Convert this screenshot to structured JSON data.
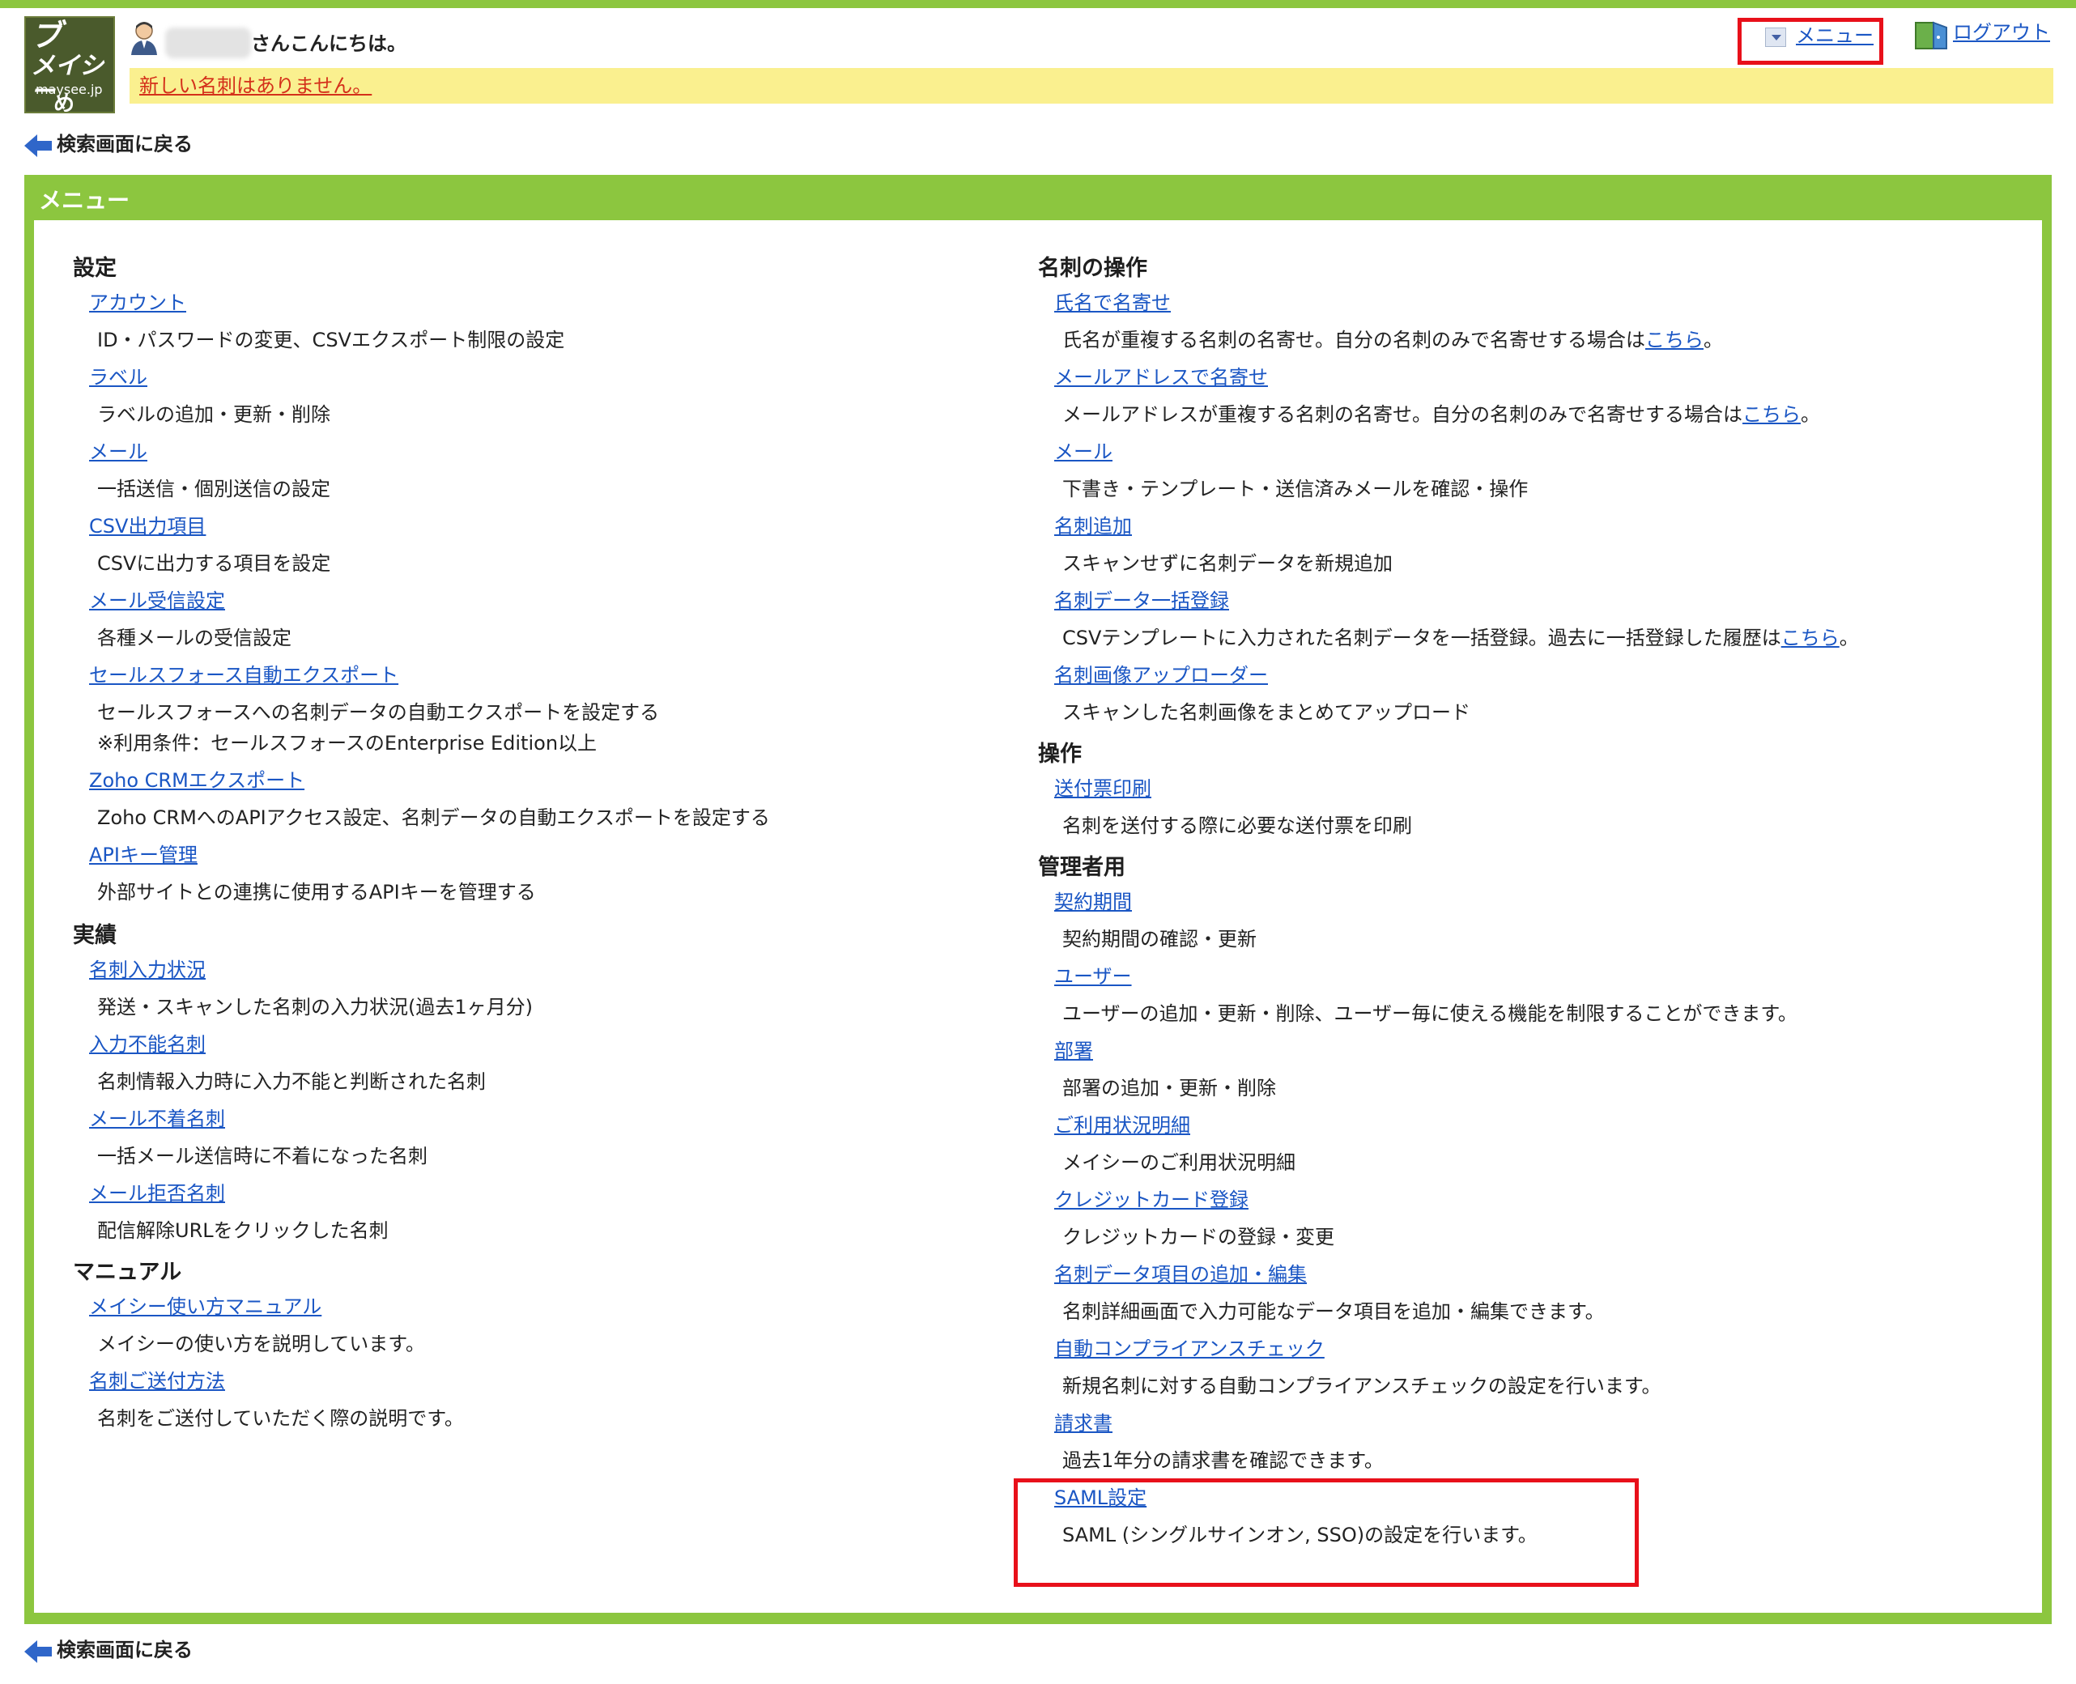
{
  "header": {
    "logo_lines": [
      "ブ",
      "メイシー",
      "maysee.jp",
      "め"
    ],
    "greeting": "さんこんにちは。",
    "notice": "新しい名刺はありません。",
    "menu_label": "メニュー",
    "logout_label": "ログアウト"
  },
  "back_label": "検索画面に戻る",
  "panel": {
    "title": "メニュー"
  },
  "left": {
    "settings": {
      "heading": "設定",
      "items": [
        {
          "label": "アカウント",
          "desc": "ID・パスワードの変更、CSVエクスポート制限の設定"
        },
        {
          "label": "ラベル",
          "desc": "ラベルの追加・更新・削除"
        },
        {
          "label": "メール",
          "desc": "一括送信・個別送信の設定"
        },
        {
          "label": "CSV出力項目",
          "desc": "CSVに出力する項目を設定"
        },
        {
          "label": "メール受信設定",
          "desc": "各種メールの受信設定"
        },
        {
          "label": "セールスフォース自動エクスポート",
          "desc": "セールスフォースへの名刺データの自動エクスポートを設定する",
          "desc2": "※利用条件：セールスフォースのEnterprise Edition以上"
        },
        {
          "label": "Zoho CRMエクスポート",
          "desc": "Zoho CRMへのAPIアクセス設定、名刺データの自動エクスポートを設定する"
        },
        {
          "label": "APIキー管理",
          "desc": "外部サイトとの連携に使用するAPIキーを管理する"
        }
      ]
    },
    "results": {
      "heading": "実績",
      "items": [
        {
          "label": "名刺入力状況",
          "desc": "発送・スキャンした名刺の入力状況(過去1ヶ月分)"
        },
        {
          "label": "入力不能名刺",
          "desc": "名刺情報入力時に入力不能と判断された名刺"
        },
        {
          "label": "メール不着名刺",
          "desc": "一括メール送信時に不着になった名刺"
        },
        {
          "label": "メール拒否名刺",
          "desc": "配信解除URLをクリックした名刺"
        }
      ]
    },
    "manual": {
      "heading": "マニュアル",
      "items": [
        {
          "label": "メイシー使い方マニュアル",
          "desc": "メイシーの使い方を説明しています。"
        },
        {
          "label": "名刺ご送付方法",
          "desc": "名刺をご送付していただく際の説明です。"
        }
      ]
    }
  },
  "right": {
    "card_ops": {
      "heading": "名刺の操作",
      "items": [
        {
          "label": "氏名で名寄せ",
          "desc": "氏名が重複する名刺の名寄せ。自分の名刺のみで名寄せする場合は",
          "inline_link": "こちら",
          "desc_end": "。"
        },
        {
          "label": "メールアドレスで名寄せ",
          "desc": "メールアドレスが重複する名刺の名寄せ。自分の名刺のみで名寄せする場合は",
          "inline_link": "こちら",
          "desc_end": "。"
        },
        {
          "label": "メール",
          "desc": "下書き・テンプレート・送信済みメールを確認・操作"
        },
        {
          "label": "名刺追加",
          "desc": "スキャンせずに名刺データを新規追加"
        },
        {
          "label": "名刺データ一括登録",
          "desc": "CSVテンプレートに入力された名刺データを一括登録。過去に一括登録した履歴は",
          "inline_link": "こちら",
          "desc_end": "。"
        },
        {
          "label": "名刺画像アップローダー",
          "desc": "スキャンした名刺画像をまとめてアップロード"
        }
      ]
    },
    "ops": {
      "heading": "操作",
      "items": [
        {
          "label": "送付票印刷",
          "desc": "名刺を送付する際に必要な送付票を印刷"
        }
      ]
    },
    "admin": {
      "heading": "管理者用",
      "items": [
        {
          "label": "契約期間",
          "desc": "契約期間の確認・更新"
        },
        {
          "label": "ユーザー",
          "desc": "ユーザーの追加・更新・削除、ユーザー毎に使える機能を制限することができます。"
        },
        {
          "label": "部署",
          "desc": "部署の追加・更新・削除"
        },
        {
          "label": "ご利用状況明細",
          "desc": "メイシーのご利用状況明細"
        },
        {
          "label": "クレジットカード登録",
          "desc": "クレジットカードの登録・変更"
        },
        {
          "label": "名刺データ項目の追加・編集",
          "desc": "名刺詳細画面で入力可能なデータ項目を追加・編集できます。"
        },
        {
          "label": "自動コンプライアンスチェック",
          "desc": "新規名刺に対する自動コンプライアンスチェックの設定を行います。"
        },
        {
          "label": "請求書",
          "desc": "過去1年分の請求書を確認できます。"
        },
        {
          "label": "SAML設定",
          "desc": "SAML (シングルサインオン, SSO)の設定を行います。"
        }
      ]
    }
  },
  "colors": {
    "accent_green": "#8cc63f",
    "notice_yellow": "#faf08f",
    "notice_red": "#d4301a",
    "link_blue": "#1a56c4",
    "highlight_red": "#e8101a"
  }
}
